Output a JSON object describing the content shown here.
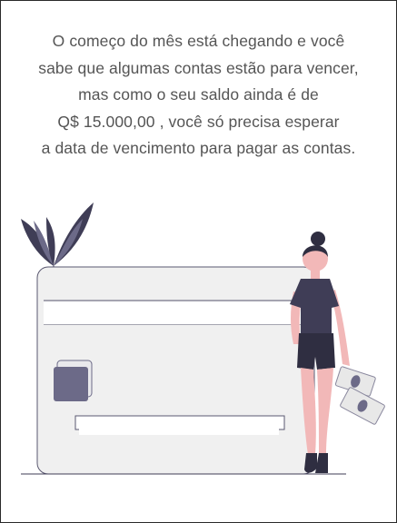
{
  "message": {
    "lines": [
      "O começo do mês está chegando e você",
      "sabe que algumas contas estão para vencer,",
      "mas como o seu saldo ainda é de",
      "Q$ 15.000,00 , você só precisa esperar",
      "a data de vencimento para pagar as contas."
    ]
  },
  "illustration": {
    "colors": {
      "card_fill": "#f0f0f0",
      "card_stroke": "#3f3d56",
      "plant_dark": "#3f3d56",
      "plant_mid": "#6c6a88",
      "chip": "#6c6a88",
      "skin": "#f2b8b8",
      "shirt": "#3f3d56",
      "hair": "#2f2e41",
      "bill": "#e8e8e8"
    },
    "icons": [
      "credit-card-icon",
      "plant-icon",
      "woman-figure-icon",
      "money-bill-icon"
    ]
  }
}
